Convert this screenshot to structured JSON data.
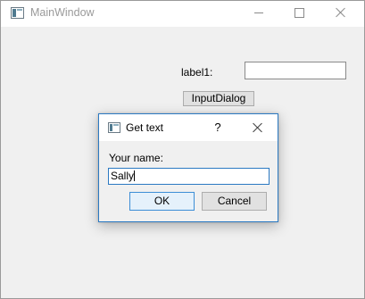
{
  "main_window": {
    "title": "MainWindow",
    "label": "label1:",
    "line_edit_value": "",
    "button_label": "InputDialog"
  },
  "dialog": {
    "title": "Get text",
    "help_glyph": "?",
    "prompt": "Your name:",
    "input_value": "Sally",
    "ok_label": "OK",
    "cancel_label": "Cancel"
  },
  "icons": {
    "app": "app-window-icon",
    "minimize": "minimize-icon",
    "maximize": "maximize-icon",
    "close": "close-icon"
  },
  "colors": {
    "dialog_border": "#2b79c2",
    "default_button_bg": "#e5f1fb",
    "window_bg": "#f0f0f0"
  }
}
